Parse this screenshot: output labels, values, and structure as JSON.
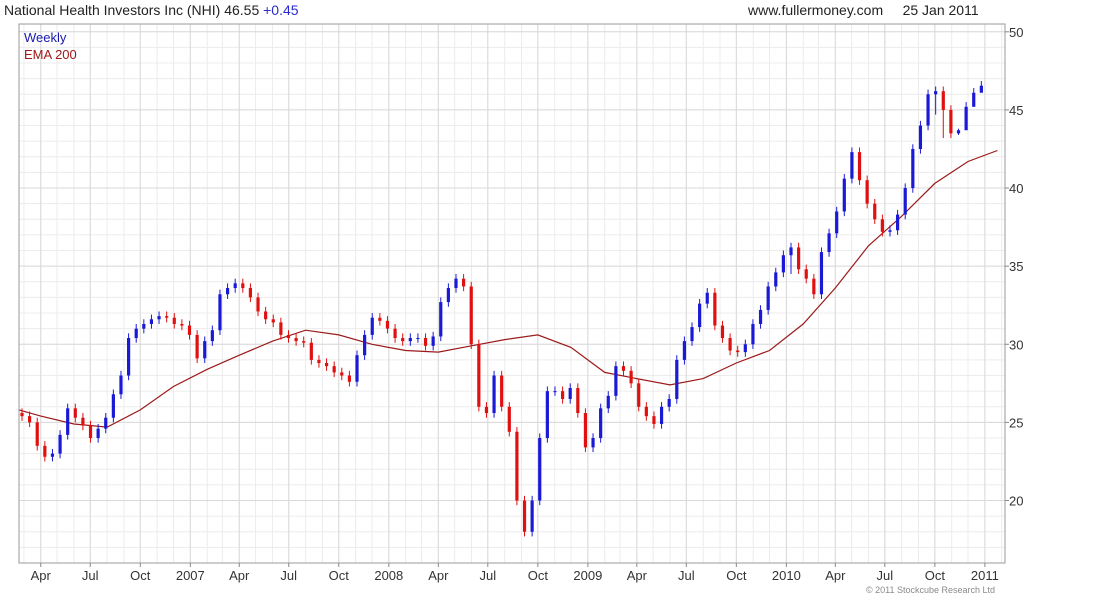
{
  "header": {
    "title": "National Health Investors Inc (NHI) 46.55",
    "change": "+0.45",
    "source": "www.fullermoney.com",
    "date": "25 Jan 2011"
  },
  "legend": {
    "period": "Weekly",
    "indicator": "EMA 200"
  },
  "footer": {
    "copyright": "© 2011 Stockcube Research Ltd"
  },
  "colors": {
    "up": "#1a1ad6",
    "down": "#e01010",
    "ema": "#9b1a1a",
    "grid": "#d9d9d9"
  },
  "chart_data": {
    "type": "line",
    "ylim": [
      16,
      50.5
    ],
    "yticks": [
      20,
      25,
      30,
      35,
      40,
      45,
      50
    ],
    "xlim": [
      "2006-02-20",
      "2011-02-07"
    ],
    "x_ticks": [
      {
        "label": "Apr",
        "date": "2006-04-01"
      },
      {
        "label": "Jul",
        "date": "2006-07-01"
      },
      {
        "label": "Oct",
        "date": "2006-10-01"
      },
      {
        "label": "2007",
        "date": "2007-01-01"
      },
      {
        "label": "Apr",
        "date": "2007-04-01"
      },
      {
        "label": "Jul",
        "date": "2007-07-01"
      },
      {
        "label": "Oct",
        "date": "2007-10-01"
      },
      {
        "label": "2008",
        "date": "2008-01-01"
      },
      {
        "label": "Apr",
        "date": "2008-04-01"
      },
      {
        "label": "Jul",
        "date": "2008-07-01"
      },
      {
        "label": "Oct",
        "date": "2008-10-01"
      },
      {
        "label": "2009",
        "date": "2009-01-01"
      },
      {
        "label": "Apr",
        "date": "2009-04-01"
      },
      {
        "label": "Jul",
        "date": "2009-07-01"
      },
      {
        "label": "Oct",
        "date": "2009-10-01"
      },
      {
        "label": "2010",
        "date": "2010-01-01"
      },
      {
        "label": "Apr",
        "date": "2010-04-01"
      },
      {
        "label": "Jul",
        "date": "2010-07-01"
      },
      {
        "label": "Oct",
        "date": "2010-10-01"
      },
      {
        "label": "2011",
        "date": "2011-01-01"
      }
    ],
    "series": [
      {
        "name": "Weekly",
        "style": "candlestick",
        "dates": [
          "2006-02-20",
          "2006-03-06",
          "2006-03-20",
          "2006-04-03",
          "2006-04-17",
          "2006-05-01",
          "2006-05-15",
          "2006-05-29",
          "2006-06-12",
          "2006-06-26",
          "2006-07-10",
          "2006-07-24",
          "2006-08-07",
          "2006-08-21",
          "2006-09-04",
          "2006-09-18",
          "2006-10-02",
          "2006-10-16",
          "2006-10-30",
          "2006-11-13",
          "2006-11-27",
          "2006-12-11",
          "2006-12-25",
          "2007-01-08",
          "2007-01-22",
          "2007-02-05",
          "2007-02-19",
          "2007-03-05",
          "2007-03-19",
          "2007-04-02",
          "2007-04-16",
          "2007-04-30",
          "2007-05-14",
          "2007-05-28",
          "2007-06-11",
          "2007-06-25",
          "2007-07-09",
          "2007-07-23",
          "2007-08-06",
          "2007-08-20",
          "2007-09-03",
          "2007-09-17",
          "2007-10-01",
          "2007-10-15",
          "2007-10-29",
          "2007-11-12",
          "2007-11-26",
          "2007-12-10",
          "2007-12-24",
          "2008-01-07",
          "2008-01-21",
          "2008-02-04",
          "2008-02-18",
          "2008-03-03",
          "2008-03-17",
          "2008-03-31",
          "2008-04-14",
          "2008-04-28",
          "2008-05-12",
          "2008-05-26",
          "2008-06-09",
          "2008-06-23",
          "2008-07-07",
          "2008-07-21",
          "2008-08-04",
          "2008-08-18",
          "2008-09-01",
          "2008-09-15",
          "2008-09-29",
          "2008-10-13",
          "2008-10-27",
          "2008-11-10",
          "2008-11-24",
          "2008-12-08",
          "2008-12-22",
          "2009-01-05",
          "2009-01-19",
          "2009-02-02",
          "2009-02-16",
          "2009-03-02",
          "2009-03-16",
          "2009-03-30",
          "2009-04-13",
          "2009-04-27",
          "2009-05-11",
          "2009-05-25",
          "2009-06-08",
          "2009-06-22",
          "2009-07-06",
          "2009-07-20",
          "2009-08-03",
          "2009-08-17",
          "2009-08-31",
          "2009-09-14",
          "2009-09-28",
          "2009-10-12",
          "2009-10-26",
          "2009-11-09",
          "2009-11-23",
          "2009-12-07",
          "2009-12-21",
          "2010-01-04",
          "2010-01-18",
          "2010-02-01",
          "2010-02-15",
          "2010-03-01",
          "2010-03-15",
          "2010-03-29",
          "2010-04-12",
          "2010-04-26",
          "2010-05-10",
          "2010-05-24",
          "2010-06-07",
          "2010-06-21",
          "2010-07-05",
          "2010-07-19",
          "2010-08-02",
          "2010-08-16",
          "2010-08-30",
          "2010-09-13",
          "2010-09-27",
          "2010-10-11",
          "2010-10-25",
          "2010-11-08",
          "2010-11-22",
          "2010-12-06",
          "2010-12-20",
          "2011-01-03",
          "2011-01-17"
        ],
        "open": [
          25.6,
          25.4,
          25.0,
          23.5,
          22.8,
          23.0,
          24.2,
          25.9,
          25.3,
          24.8,
          24.0,
          24.6,
          25.3,
          26.8,
          28.0,
          30.4,
          31.0,
          31.3,
          31.6,
          31.8,
          31.7,
          31.3,
          31.2,
          30.6,
          29.1,
          30.2,
          30.9,
          33.2,
          33.6,
          33.9,
          33.6,
          33.0,
          32.1,
          31.6,
          31.4,
          30.6,
          30.4,
          30.2,
          30.1,
          29.0,
          28.8,
          28.6,
          28.2,
          28.0,
          27.6,
          29.3,
          30.6,
          31.7,
          31.5,
          31.0,
          30.4,
          30.2,
          30.4,
          30.4,
          29.9,
          30.5,
          32.7,
          33.6,
          34.2,
          33.7,
          30.0,
          26.0,
          25.6,
          28.0,
          26.0,
          24.4,
          20.0,
          18.0,
          20.0,
          24.0,
          27.0,
          27.0,
          26.5,
          27.2,
          25.6,
          23.4,
          24.0,
          25.9,
          26.7,
          28.6,
          28.3,
          27.5,
          26.0,
          25.4,
          24.9,
          26.0,
          26.5,
          29.0,
          30.2,
          31.1,
          32.6,
          33.3,
          31.2,
          30.4,
          29.6,
          29.5,
          30.0,
          31.3,
          32.2,
          33.7,
          34.6,
          35.7,
          36.2,
          34.8,
          34.2,
          33.2,
          35.9,
          37.1,
          38.5,
          40.6,
          42.3,
          40.5,
          39.0,
          38.0,
          37.2,
          37.3,
          38.3,
          40.0,
          42.5,
          44.0,
          46.0,
          46.2,
          45.0,
          43.5,
          43.7,
          45.2,
          46.1
        ],
        "close": [
          25.4,
          25.0,
          23.5,
          22.8,
          23.0,
          24.2,
          25.9,
          25.3,
          24.8,
          24.0,
          24.6,
          25.3,
          26.8,
          28.0,
          30.4,
          31.0,
          31.3,
          31.6,
          31.8,
          31.7,
          31.3,
          31.2,
          30.6,
          29.1,
          30.2,
          30.9,
          33.2,
          33.6,
          33.9,
          33.6,
          33.0,
          32.1,
          31.6,
          31.4,
          30.6,
          30.4,
          30.2,
          30.1,
          29.0,
          28.8,
          28.6,
          28.2,
          28.0,
          27.6,
          29.3,
          30.6,
          31.7,
          31.5,
          31.0,
          30.4,
          30.2,
          30.4,
          30.4,
          29.9,
          30.5,
          32.7,
          33.6,
          34.2,
          33.7,
          30.0,
          26.0,
          25.6,
          28.0,
          26.0,
          24.4,
          20.0,
          18.0,
          20.0,
          24.0,
          27.0,
          27.0,
          26.5,
          27.2,
          25.6,
          23.4,
          24.0,
          25.9,
          26.7,
          28.6,
          28.3,
          27.5,
          26.0,
          25.4,
          24.9,
          26.0,
          26.5,
          29.0,
          30.2,
          31.1,
          32.6,
          33.3,
          31.2,
          30.4,
          29.6,
          29.5,
          30.0,
          31.3,
          32.2,
          33.7,
          34.6,
          35.7,
          36.2,
          34.8,
          34.2,
          33.2,
          35.9,
          37.1,
          38.5,
          40.6,
          42.3,
          40.5,
          39.0,
          38.0,
          37.2,
          37.3,
          38.3,
          40.0,
          42.5,
          44.0,
          46.0,
          46.2,
          45.0,
          43.5,
          43.7,
          45.2,
          46.1,
          46.55
        ],
        "high": [
          25.9,
          25.7,
          25.3,
          23.8,
          23.3,
          24.5,
          26.2,
          26.2,
          25.6,
          25.1,
          24.9,
          25.6,
          27.1,
          28.3,
          30.7,
          31.3,
          31.6,
          31.9,
          32.1,
          32.1,
          32.0,
          31.6,
          31.5,
          30.9,
          30.5,
          31.2,
          33.5,
          33.9,
          34.2,
          34.2,
          33.9,
          33.3,
          32.4,
          31.9,
          31.7,
          30.9,
          30.7,
          30.5,
          30.4,
          29.3,
          29.1,
          28.9,
          28.5,
          28.3,
          29.6,
          30.9,
          32.0,
          32.0,
          31.8,
          31.3,
          30.7,
          30.7,
          30.7,
          30.7,
          30.8,
          33.0,
          33.9,
          34.5,
          34.5,
          34.0,
          30.3,
          26.3,
          28.3,
          28.3,
          26.3,
          24.7,
          20.3,
          20.3,
          24.3,
          27.3,
          27.3,
          27.3,
          27.5,
          27.5,
          25.9,
          24.3,
          26.2,
          27.0,
          28.9,
          28.9,
          28.6,
          27.8,
          26.3,
          25.7,
          26.3,
          26.8,
          29.3,
          30.5,
          31.4,
          32.9,
          33.6,
          33.6,
          31.5,
          30.7,
          29.9,
          30.3,
          31.6,
          32.5,
          34.0,
          34.9,
          36.0,
          36.5,
          36.5,
          35.1,
          34.5,
          36.2,
          37.4,
          38.8,
          40.9,
          42.6,
          42.6,
          40.8,
          39.3,
          38.3,
          37.6,
          38.6,
          40.3,
          42.8,
          44.3,
          46.3,
          46.5,
          46.5,
          45.3,
          43.8,
          45.5,
          46.4,
          46.85
        ],
        "low": [
          25.1,
          24.7,
          23.2,
          22.5,
          22.5,
          22.7,
          23.9,
          25.0,
          24.5,
          23.7,
          23.7,
          24.3,
          25.0,
          26.5,
          27.7,
          30.1,
          30.7,
          31.0,
          31.3,
          31.4,
          31.0,
          30.9,
          30.3,
          28.8,
          28.8,
          29.9,
          30.6,
          32.9,
          33.3,
          33.3,
          32.7,
          31.8,
          31.3,
          31.1,
          30.3,
          30.1,
          29.9,
          29.8,
          28.7,
          28.5,
          28.3,
          27.9,
          27.7,
          27.3,
          27.3,
          29.0,
          30.3,
          31.2,
          30.7,
          30.1,
          29.9,
          29.9,
          30.1,
          29.6,
          29.6,
          30.2,
          32.4,
          33.3,
          33.4,
          29.7,
          25.7,
          25.3,
          25.3,
          25.7,
          24.1,
          19.7,
          17.7,
          17.7,
          19.7,
          23.7,
          26.7,
          26.2,
          26.2,
          25.3,
          23.1,
          23.1,
          23.7,
          25.6,
          26.4,
          28.0,
          27.2,
          25.7,
          25.1,
          24.6,
          24.6,
          25.7,
          26.2,
          28.7,
          29.9,
          30.8,
          32.3,
          30.9,
          30.1,
          29.3,
          29.2,
          29.2,
          29.7,
          31.0,
          31.9,
          33.4,
          34.3,
          34.5,
          34.5,
          33.9,
          32.9,
          32.9,
          35.6,
          36.8,
          38.2,
          40.3,
          40.2,
          38.7,
          37.7,
          36.9,
          36.9,
          37.0,
          38.0,
          39.7,
          42.2,
          43.7,
          44.7,
          43.2,
          43.2,
          43.4,
          44.9,
          45.8,
          46.25
        ]
      },
      {
        "name": "EMA 200",
        "style": "line",
        "dates": [
          "2006-02-20",
          "2006-04-01",
          "2006-06-01",
          "2006-08-01",
          "2006-10-01",
          "2006-12-01",
          "2007-02-01",
          "2007-04-01",
          "2007-06-01",
          "2007-08-01",
          "2007-10-01",
          "2007-12-01",
          "2008-02-01",
          "2008-04-01",
          "2008-06-01",
          "2008-08-01",
          "2008-10-01",
          "2008-12-01",
          "2009-02-01",
          "2009-04-01",
          "2009-06-01",
          "2009-08-01",
          "2009-10-01",
          "2009-12-01",
          "2010-02-01",
          "2010-04-01",
          "2010-06-01",
          "2010-08-01",
          "2010-10-01",
          "2010-12-01",
          "2011-01-24"
        ],
        "values": [
          25.8,
          25.4,
          24.9,
          24.7,
          25.8,
          27.3,
          28.4,
          29.3,
          30.2,
          30.9,
          30.6,
          30.0,
          29.6,
          29.5,
          29.9,
          30.3,
          30.6,
          29.8,
          28.2,
          27.8,
          27.4,
          27.8,
          28.8,
          29.6,
          31.3,
          33.6,
          36.3,
          38.2,
          40.3,
          41.7,
          42.4
        ]
      }
    ]
  }
}
